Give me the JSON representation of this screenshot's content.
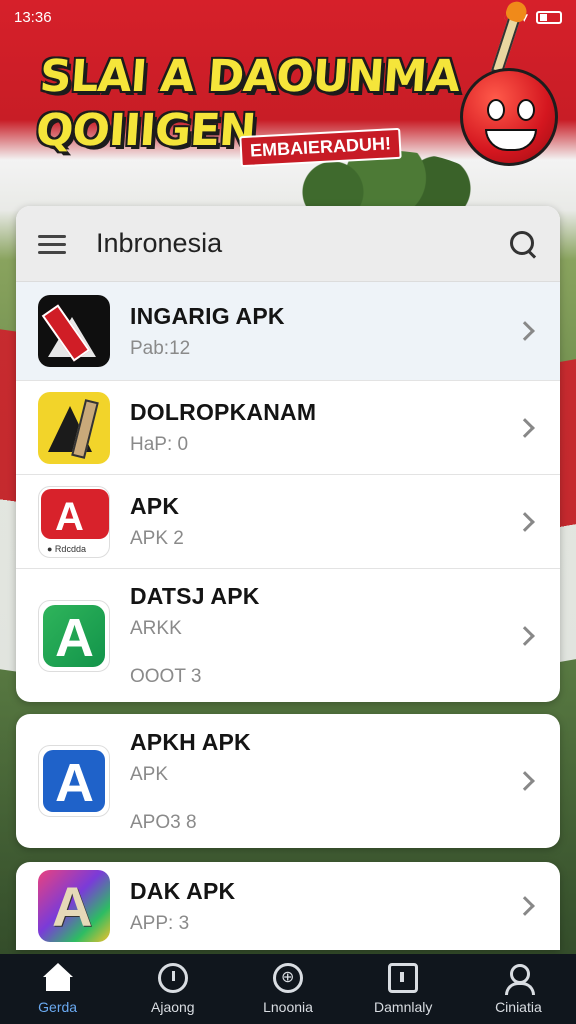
{
  "status_bar": {
    "time": "13:36",
    "battery_icon": "battery-icon",
    "signal_icon": "signal-icon"
  },
  "banner": {
    "title_line1": "SLAI A DAOUNMA",
    "title_line2": "QOIIIGEN",
    "tag": "EMBAIERADUH!"
  },
  "search": {
    "title": "Inbronesia",
    "menu_icon": "menu-icon",
    "search_icon": "search-icon"
  },
  "apps_main": [
    {
      "name": "INGARIG APK",
      "sub": "Pab:12",
      "sub2": "",
      "icon": "app-icon-black"
    },
    {
      "name": "DOLROPKANAM",
      "sub": "HaP: 0",
      "sub2": "",
      "icon": "app-icon-yellow"
    },
    {
      "name": "APK",
      "sub": "APK 2",
      "sub2": "",
      "icon": "app-icon-red"
    },
    {
      "name": "DATSJ APK",
      "sub": "ARKK",
      "sub2": "OOOT 3",
      "icon": "app-icon-green"
    }
  ],
  "apps_card2": [
    {
      "name": "APKH APK",
      "sub": "APK",
      "sub2": "APO3 8",
      "icon": "app-icon-blue"
    }
  ],
  "apps_card3": [
    {
      "name": "DAK APK",
      "sub": "APP: 3",
      "sub2": "",
      "icon": "app-icon-gradient"
    }
  ],
  "bottom_nav": [
    {
      "label": "Gerda",
      "icon": "home-icon",
      "active": true
    },
    {
      "label": "Ajaong",
      "icon": "clock-icon",
      "active": false
    },
    {
      "label": "Lnoonia",
      "icon": "chat-icon",
      "active": false
    },
    {
      "label": "Damnlaly",
      "icon": "box-icon",
      "active": false
    },
    {
      "label": "Ciniatia",
      "icon": "user-icon",
      "active": false
    }
  ],
  "colors": {
    "flag_red": "#d6202a",
    "banner_yellow": "#f5e53a",
    "nav_bg": "#10161d",
    "nav_active": "#6aa9f0"
  }
}
